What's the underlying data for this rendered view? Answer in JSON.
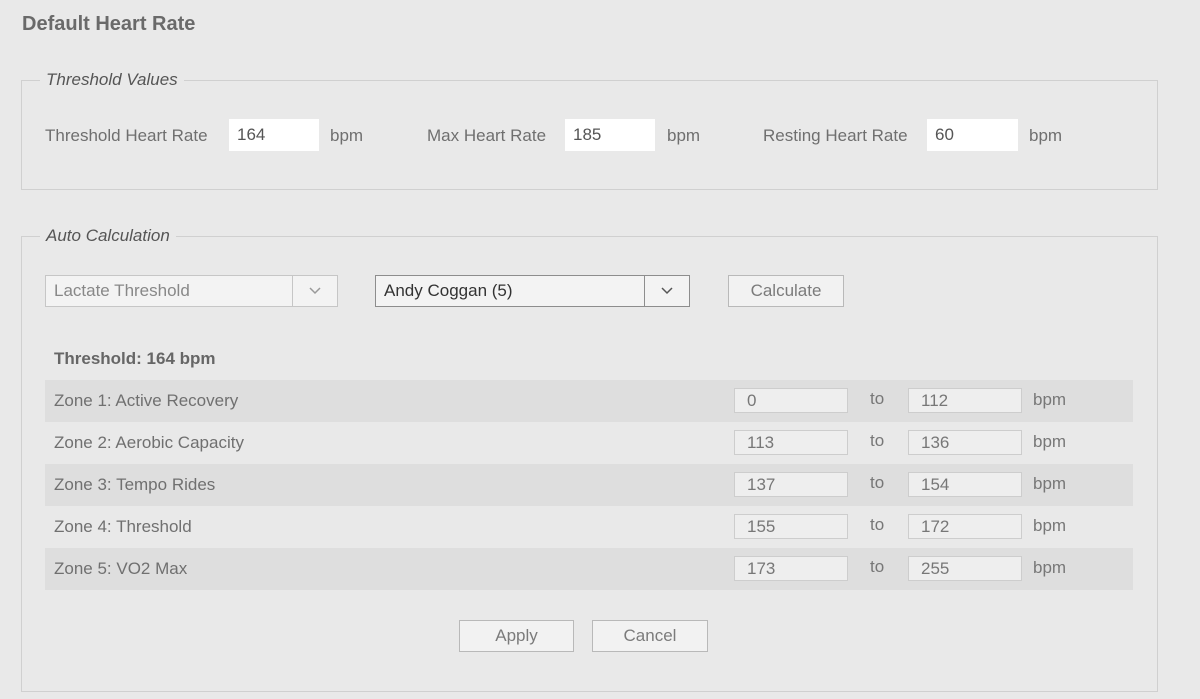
{
  "page_title": "Default Heart Rate",
  "threshold_values": {
    "legend": "Threshold Values",
    "threshold_hr": {
      "label": "Threshold Heart Rate",
      "value": "164",
      "unit": "bpm"
    },
    "max_hr": {
      "label": "Max Heart Rate",
      "value": "185",
      "unit": "bpm"
    },
    "resting_hr": {
      "label": "Resting Heart Rate",
      "value": "60",
      "unit": "bpm"
    }
  },
  "auto_calculation": {
    "legend": "Auto Calculation",
    "method_select": "Lactate Threshold",
    "model_select": "Andy Coggan (5)",
    "calculate_label": "Calculate",
    "threshold_heading": "Threshold: 164 bpm",
    "zones": [
      {
        "name": "Zone 1: Active Recovery",
        "from": "0",
        "sep": "to",
        "to": "112",
        "unit": "bpm"
      },
      {
        "name": "Zone 2: Aerobic Capacity",
        "from": "113",
        "sep": "to",
        "to": "136",
        "unit": "bpm"
      },
      {
        "name": "Zone 3: Tempo Rides",
        "from": "137",
        "sep": "to",
        "to": "154",
        "unit": "bpm"
      },
      {
        "name": "Zone 4: Threshold",
        "from": "155",
        "sep": "to",
        "to": "172",
        "unit": "bpm"
      },
      {
        "name": "Zone 5: VO2 Max",
        "from": "173",
        "sep": "to",
        "to": "255",
        "unit": "bpm"
      }
    ],
    "apply_label": "Apply",
    "cancel_label": "Cancel"
  },
  "icons": {
    "dropdown": "chevron-down-icon"
  }
}
